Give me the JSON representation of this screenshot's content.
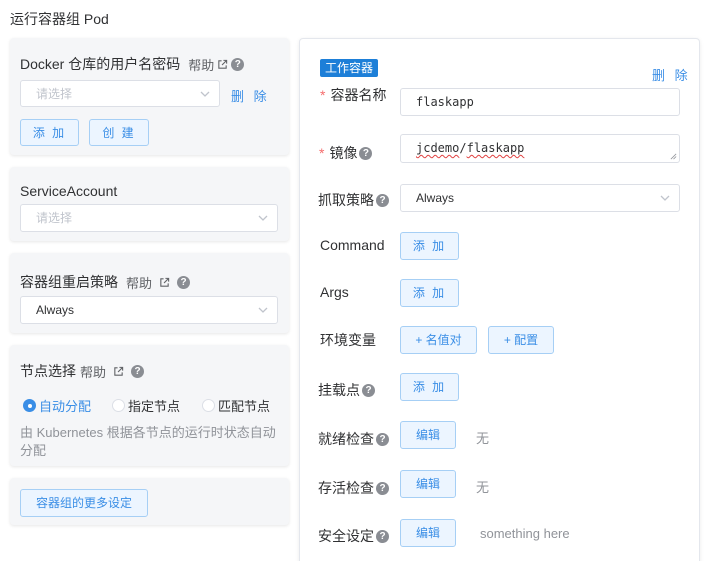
{
  "page_title": "运行容器组 Pod",
  "left": {
    "docker_card": {
      "title": "Docker 仓库的用户名密码",
      "help": "帮助",
      "select_placeholder": "请选择",
      "delete": "删 除",
      "add": "添 加",
      "create": "创 建"
    },
    "service_account": {
      "title": "ServiceAccount",
      "select_placeholder": "请选择"
    },
    "restart_policy": {
      "title": "容器组重启策略",
      "help": "帮助",
      "value": "Always"
    },
    "node_selection": {
      "title": "节点选择",
      "help": "帮助",
      "options": [
        "自动分配",
        "指定节点",
        "匹配节点"
      ],
      "selected": "自动分配",
      "description": "由 Kubernetes 根据各节点的运行时状态自动分配"
    },
    "more_settings": "容器组的更多设定"
  },
  "right": {
    "tag": "工作容器",
    "delete": "删 除",
    "name_label": "容器名称",
    "name_value": "flaskapp",
    "image_label": "镜像",
    "image_value_1": "jcdemo",
    "image_value_sep": "/",
    "image_value_2": "flaskapp",
    "pull_label": "抓取策略",
    "pull_value": "Always",
    "command_label": "Command",
    "command_btn": "添 加",
    "args_label": "Args",
    "args_btn": "添 加",
    "env_label": "环境变量",
    "env_btn_kv": "+ 名值对",
    "env_btn_cfg": "+ 配置",
    "mount_label": "挂载点",
    "mount_btn": "添 加",
    "readiness_label": "就绪检查",
    "readiness_btn": "编辑",
    "readiness_value": "无",
    "liveness_label": "存活检查",
    "liveness_btn": "编辑",
    "liveness_value": "无",
    "security_label": "安全设定",
    "security_btn": "编辑",
    "security_value": "something here"
  },
  "colors": {
    "primary": "#3a8ee6",
    "required": "#f56c6c",
    "tag_bg": "#1d7fd8"
  },
  "icons": [
    "external-link-icon",
    "question-icon",
    "chevron-down-icon"
  ]
}
